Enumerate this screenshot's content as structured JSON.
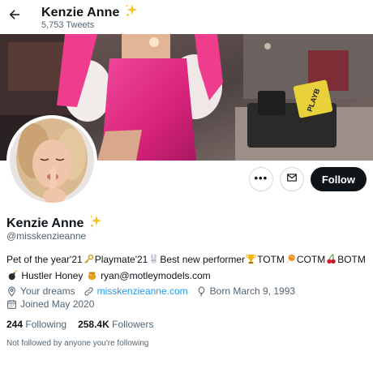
{
  "header": {
    "name": "Kenzie Anne",
    "sparkle_icon": "sparkles-emoji",
    "tweets_count": "5,753 Tweets",
    "back_icon": "arrow-left-icon"
  },
  "banner": {
    "description_icon": "banner-photo",
    "sign_text": "PLAYB"
  },
  "avatar": {
    "icon": "profile-photo"
  },
  "actions": {
    "more_icon": "more-horizontal-icon",
    "more_label": "•••",
    "message_icon": "envelope-icon",
    "follow_label": "Follow"
  },
  "profile": {
    "name": "Kenzie Anne",
    "handle": "@misskenzieanne"
  },
  "bio": {
    "line1_a": "Pet of the year'21",
    "line1_b": "Playmate'21",
    "line1_c": "Best new performer",
    "line1_d": "TOTM",
    "line1_e": "COTM",
    "line1_f": "BOTM",
    "line2_a": "Hustler Honey",
    "line2_b": "ryan@motleymodels.com",
    "emoji_names": [
      "key-emoji",
      "rabbit-emoji",
      "trophy-emoji",
      "lollipop-emoji",
      "cherries-emoji",
      "bomb-emoji",
      "honey-pot-emoji"
    ]
  },
  "meta": {
    "location": "Your dreams",
    "website": "misskenzieanne.com",
    "birthday": "Born March 9, 1993",
    "joined": "Joined May 2020",
    "icons": [
      "location-pin-icon",
      "link-icon",
      "balloon-icon",
      "calendar-icon"
    ]
  },
  "stats": {
    "following_count": "244",
    "following_label": "Following",
    "followers_count": "258.4K",
    "followers_label": "Followers"
  },
  "footer": {
    "not_followed": "Not followed by anyone you're following"
  },
  "colors": {
    "link": "#1d9bf0",
    "secondary_text": "#536471",
    "follow_button": "#0f1419",
    "banner_dress": "#d8237a"
  }
}
